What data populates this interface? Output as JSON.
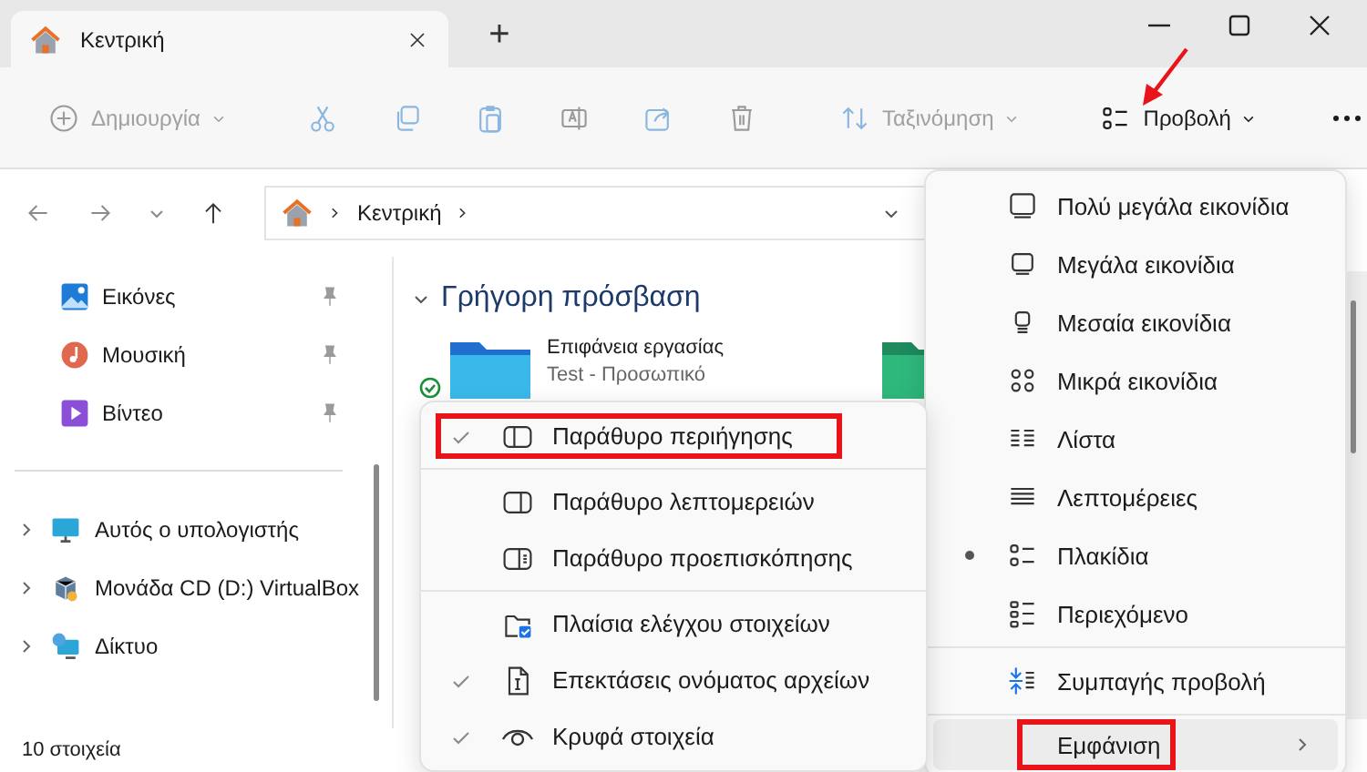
{
  "window": {
    "tab_title": "Κεντρική",
    "new_tab": "+"
  },
  "toolbar": [
    {
      "kind": "new",
      "label": "Δημιουργία",
      "disabled": true,
      "dropdown": true,
      "annotated": false
    },
    {
      "kind": "cut",
      "disabled": true,
      "annotated": false
    },
    {
      "kind": "copy",
      "disabled": true,
      "annotated": false
    },
    {
      "kind": "paste",
      "disabled": true,
      "annotated": false
    },
    {
      "kind": "rename",
      "disabled": true,
      "annotated": false
    },
    {
      "kind": "share",
      "disabled": true,
      "annotated": false
    },
    {
      "kind": "delete",
      "disabled": true,
      "annotated": false
    },
    {
      "kind": "sort",
      "label": "Ταξινόμηση",
      "disabled": true,
      "dropdown": true,
      "annotated": false
    },
    {
      "kind": "view",
      "label": "Προβολή",
      "disabled": false,
      "dropdown": true,
      "annotated": true
    },
    {
      "kind": "more",
      "disabled": false,
      "annotated": false
    }
  ],
  "address": {
    "crumbs": [
      "Κεντρική"
    ]
  },
  "sidebar": {
    "pinned": [
      {
        "label": "Εικόνες",
        "kind": "pictures"
      },
      {
        "label": "Μουσική",
        "kind": "music"
      },
      {
        "label": "Βίντεο",
        "kind": "video"
      }
    ],
    "locations": [
      {
        "label": "Αυτός ο υπολογιστής",
        "kind": "pc",
        "expanded": false
      },
      {
        "label": "Μονάδα CD (D:) VirtualBox",
        "kind": "cd",
        "expanded": false
      },
      {
        "label": "Δίκτυο",
        "kind": "network",
        "expanded": false
      }
    ]
  },
  "content": {
    "section": "Γρήγορη πρόσβαση",
    "expanded": true,
    "items": [
      {
        "kind": "desktop",
        "name": "Επιφάνεια εργασίας",
        "location": "Test - Προσωπικό",
        "synced": true
      },
      {
        "kind": "green-folder"
      }
    ]
  },
  "status_bar": {
    "count": "10 στοιχεία"
  },
  "view_menu": {
    "groups": [
      [
        {
          "kind": "xl",
          "label": "Πολύ μεγάλα εικονίδια",
          "selected": false
        },
        {
          "kind": "large",
          "label": "Μεγάλα εικονίδια",
          "selected": false
        },
        {
          "kind": "medium",
          "label": "Μεσαία εικονίδια",
          "selected": false
        },
        {
          "kind": "small",
          "label": "Μικρά εικονίδια",
          "selected": false
        },
        {
          "kind": "list",
          "label": "Λίστα",
          "selected": false
        },
        {
          "kind": "details",
          "label": "Λεπτομέρειες",
          "selected": false
        },
        {
          "kind": "tiles",
          "label": "Πλακίδια",
          "selected": true
        },
        {
          "kind": "content",
          "label": "Περιεχόμενο",
          "selected": false
        }
      ],
      [
        {
          "kind": "compact",
          "label": "Συμπαγής προβολή",
          "selected": false
        }
      ],
      [
        {
          "kind": "show",
          "label": "Εμφάνιση",
          "submenu": true,
          "hovered": true,
          "highlighted": true
        }
      ]
    ]
  },
  "show_menu": {
    "groups": [
      [
        {
          "kind": "nav",
          "label": "Παράθυρο περιήγησης",
          "checked": true,
          "highlighted": true
        }
      ],
      [
        {
          "kind": "detailspane",
          "label": "Παράθυρο λεπτομερειών",
          "checked": false,
          "highlighted": false
        },
        {
          "kind": "preview",
          "label": "Παράθυρο προεπισκόπησης",
          "checked": false,
          "highlighted": false
        }
      ],
      [
        {
          "kind": "checkboxes",
          "label": "Πλαίσια ελέγχου στοιχείων",
          "checked": false,
          "highlighted": false
        },
        {
          "kind": "extensions",
          "label": "Επεκτάσεις ονόματος αρχείων",
          "checked": true,
          "highlighted": false
        },
        {
          "kind": "hidden",
          "label": "Κρυφά στοιχεία",
          "checked": true,
          "highlighted": false
        }
      ]
    ]
  }
}
